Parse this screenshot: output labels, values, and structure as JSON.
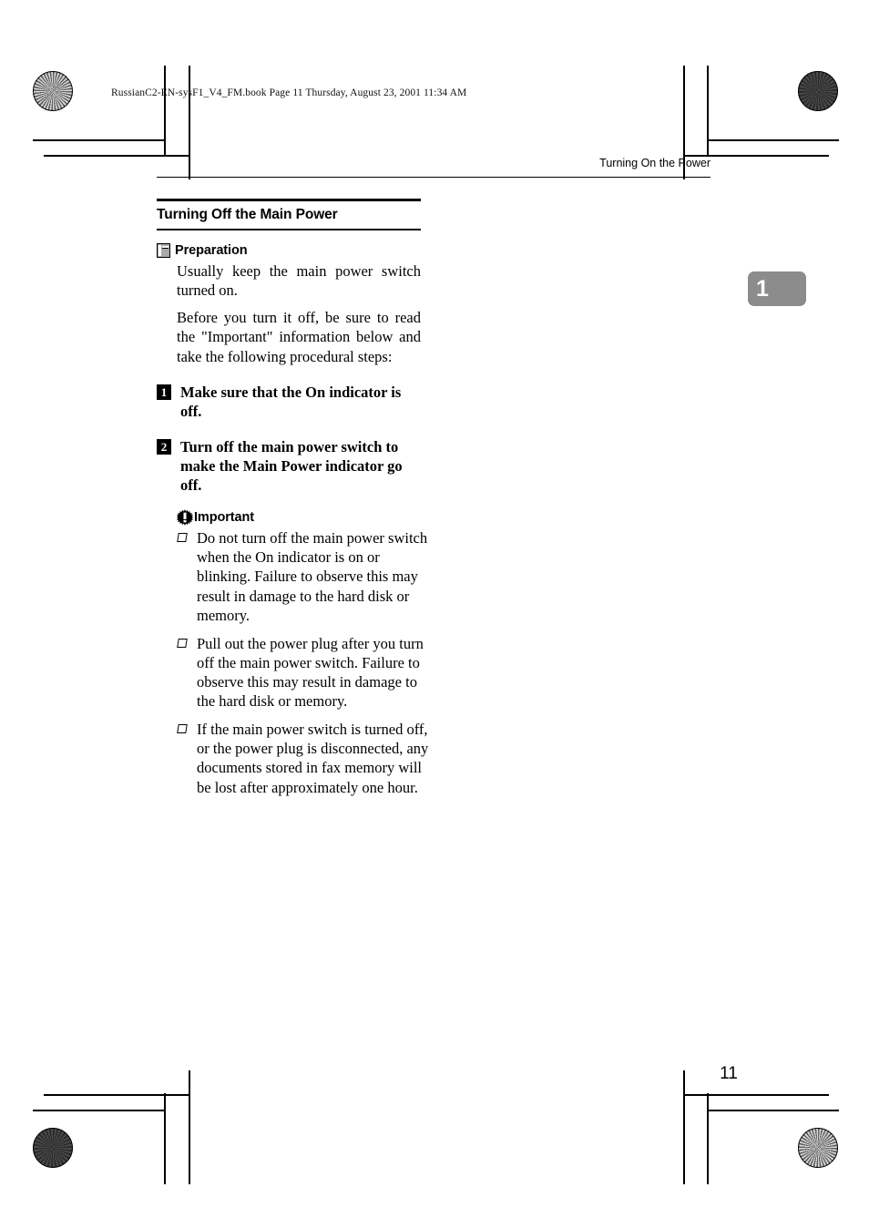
{
  "file_header": "RussianC2-EN-sysF1_V4_FM.book  Page 11  Thursday, August 23, 2001  11:34 AM",
  "running_head": "Turning On the Power",
  "section": {
    "title": "Turning Off the Main Power"
  },
  "preparation": {
    "icon": "book-icon",
    "label": "Preparation",
    "paragraphs": [
      "Usually keep the main power switch turned on.",
      "Before you turn it off, be sure to read the \"Important\" information below and take the following procedural steps:"
    ]
  },
  "steps": [
    {
      "number": "1",
      "text": "Make sure that the On indicator is off."
    },
    {
      "number": "2",
      "text": "Turn off the main power switch to make the Main Power indicator go off."
    }
  ],
  "important": {
    "icon": "important-icon",
    "label": "Important",
    "bullets": [
      "Do not turn off the main power switch when the On indicator is on or blinking. Failure to observe this may result in damage to the hard disk or memory.",
      "Pull out the power plug after you turn off the main power switch. Failure to observe this may result in damage to the hard disk or memory.",
      "If the main power switch is turned off, or the power plug is disconnected, any documents stored in fax memory will be lost after approximately one hour."
    ]
  },
  "chapter_tab": {
    "number": "1",
    "color": "#8c8c8c"
  },
  "page_number": "11"
}
